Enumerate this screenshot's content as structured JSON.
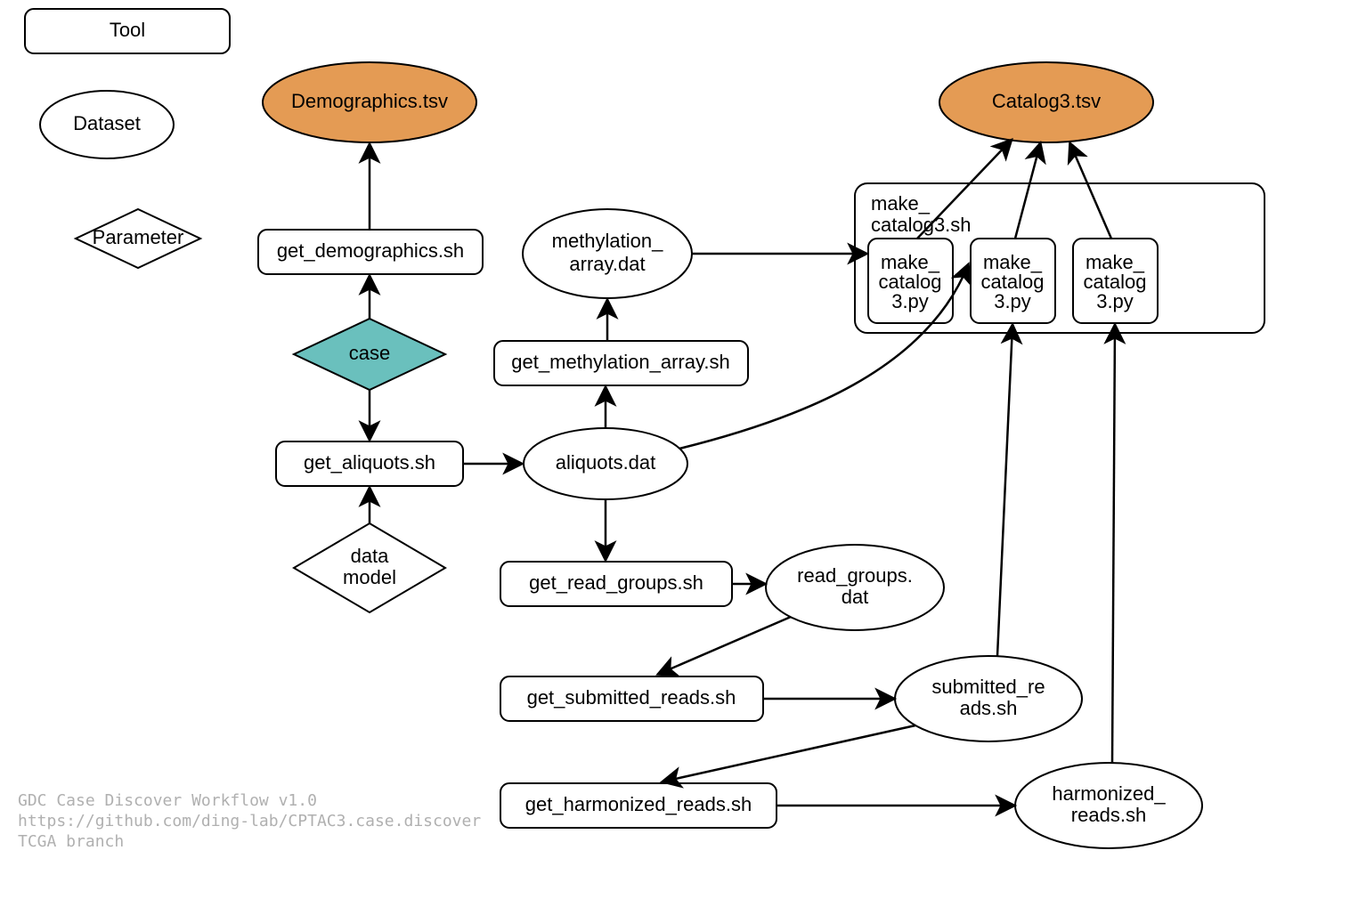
{
  "legend": {
    "tool": "Tool",
    "dataset": "Dataset",
    "parameter": "Parameter"
  },
  "nodes": {
    "demographics_tsv": "Demographics.tsv",
    "catalog3_tsv": "Catalog3.tsv",
    "get_demographics": "get_demographics.sh",
    "case": "case",
    "get_aliquots": "get_aliquots.sh",
    "data_model_l1": "data",
    "data_model_l2": "model",
    "aliquots_dat": "aliquots.dat",
    "get_methylation_array": "get_methylation_array.sh",
    "methylation_array_l1": "methylation_",
    "methylation_array_l2": "array.dat",
    "get_read_groups": "get_read_groups.sh",
    "read_groups_l1": "read_groups.",
    "read_groups_l2": "dat",
    "get_submitted_reads": "get_submitted_reads.sh",
    "submitted_reads_l1": "submitted_re",
    "submitted_reads_l2": "ads.sh",
    "get_harmonized_reads": "get_harmonized_reads.sh",
    "harmonized_reads_l1": "harmonized_",
    "harmonized_reads_l2": "reads.sh",
    "make_catalog3_sh_l1": "make_",
    "make_catalog3_sh_l2": "catalog3.sh",
    "make_catalog3_py_l1": "make_",
    "make_catalog3_py_l2": "catalog",
    "make_catalog3_py_l3": "3.py"
  },
  "footer": {
    "l1": "GDC Case Discover Workflow v1.0",
    "l2": "https://github.com/ding-lab/CPTAC3.case.discover",
    "l3": "  TCGA branch"
  }
}
